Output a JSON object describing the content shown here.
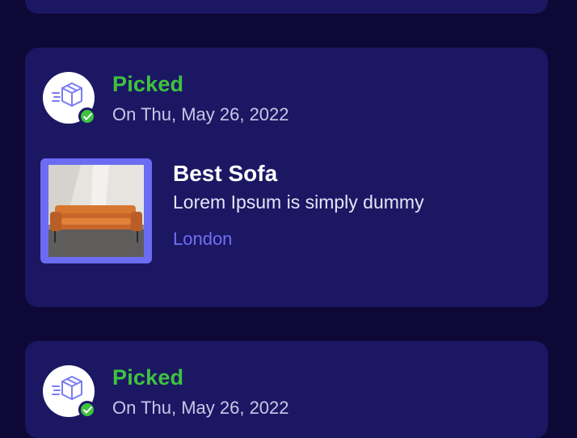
{
  "colors": {
    "background": "#0d0835",
    "card": "#1c1763",
    "status_green": "#3ec33f",
    "accent_purple": "#6e6ff4"
  },
  "orders": [
    {
      "status": "Picked",
      "date": "On Thu, May 26, 2022",
      "status_icon": "box-delivery-icon",
      "badge_icon": "check-icon",
      "product": {
        "title": "Best Sofa",
        "description": "Lorem Ipsum is simply dummy",
        "location": "London",
        "image": "sofa-image"
      }
    },
    {
      "status": "Picked",
      "date": "On Thu, May 26, 2022",
      "status_icon": "box-delivery-icon",
      "badge_icon": "check-icon"
    }
  ]
}
